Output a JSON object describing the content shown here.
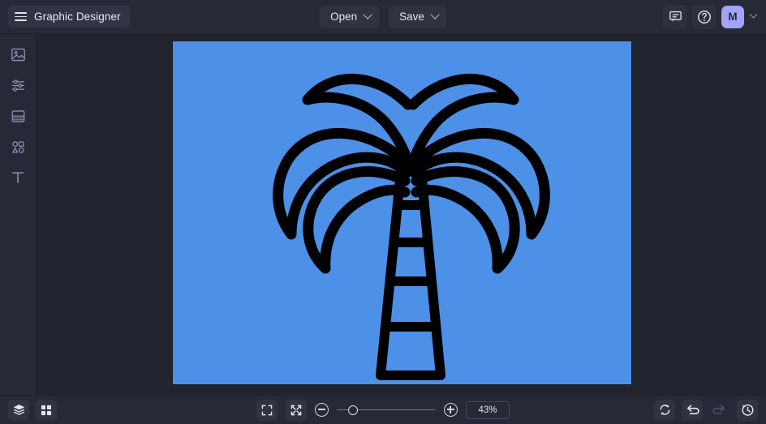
{
  "app": {
    "title": "Graphic Designer",
    "accent_avatar_color": "#a3a4f7",
    "topbar_bg": "#272a36",
    "workspace_bg": "#21242f"
  },
  "topbar": {
    "menu_icon": "hamburger-icon",
    "open_label": "Open",
    "save_label": "Save",
    "comments_icon": "comment-icon",
    "help_icon": "help-circle-icon",
    "avatar_initial": "M",
    "account_caret_icon": "chevron-down-icon"
  },
  "sidebar": {
    "items": [
      {
        "name": "image-tool",
        "icon": "image-icon"
      },
      {
        "name": "adjustments-tool",
        "icon": "sliders-icon"
      },
      {
        "name": "frame-tool",
        "icon": "frame-icon"
      },
      {
        "name": "shapes-tool",
        "icon": "shapes-icon"
      },
      {
        "name": "text-tool",
        "icon": "text-icon",
        "glyph": "T"
      }
    ]
  },
  "canvas": {
    "background_color": "#4d90e8",
    "artwork_name": "palm-tree-illustration",
    "artwork_stroke_color": "#000000"
  },
  "bottombar": {
    "layers_icon": "layers-icon",
    "grid_icon": "grid-icon",
    "fit_screen_icon": "fit-to-screen-icon",
    "shrink_icon": "collapse-arrows-icon",
    "zoom_out_icon": "minus-circle-icon",
    "zoom_in_icon": "plus-circle-icon",
    "zoom_value": "43%",
    "zoom_slider_position_percent": 12,
    "refresh_icon": "sync-icon",
    "undo_icon": "undo-icon",
    "redo_icon": "redo-icon",
    "history_icon": "history-icon"
  }
}
